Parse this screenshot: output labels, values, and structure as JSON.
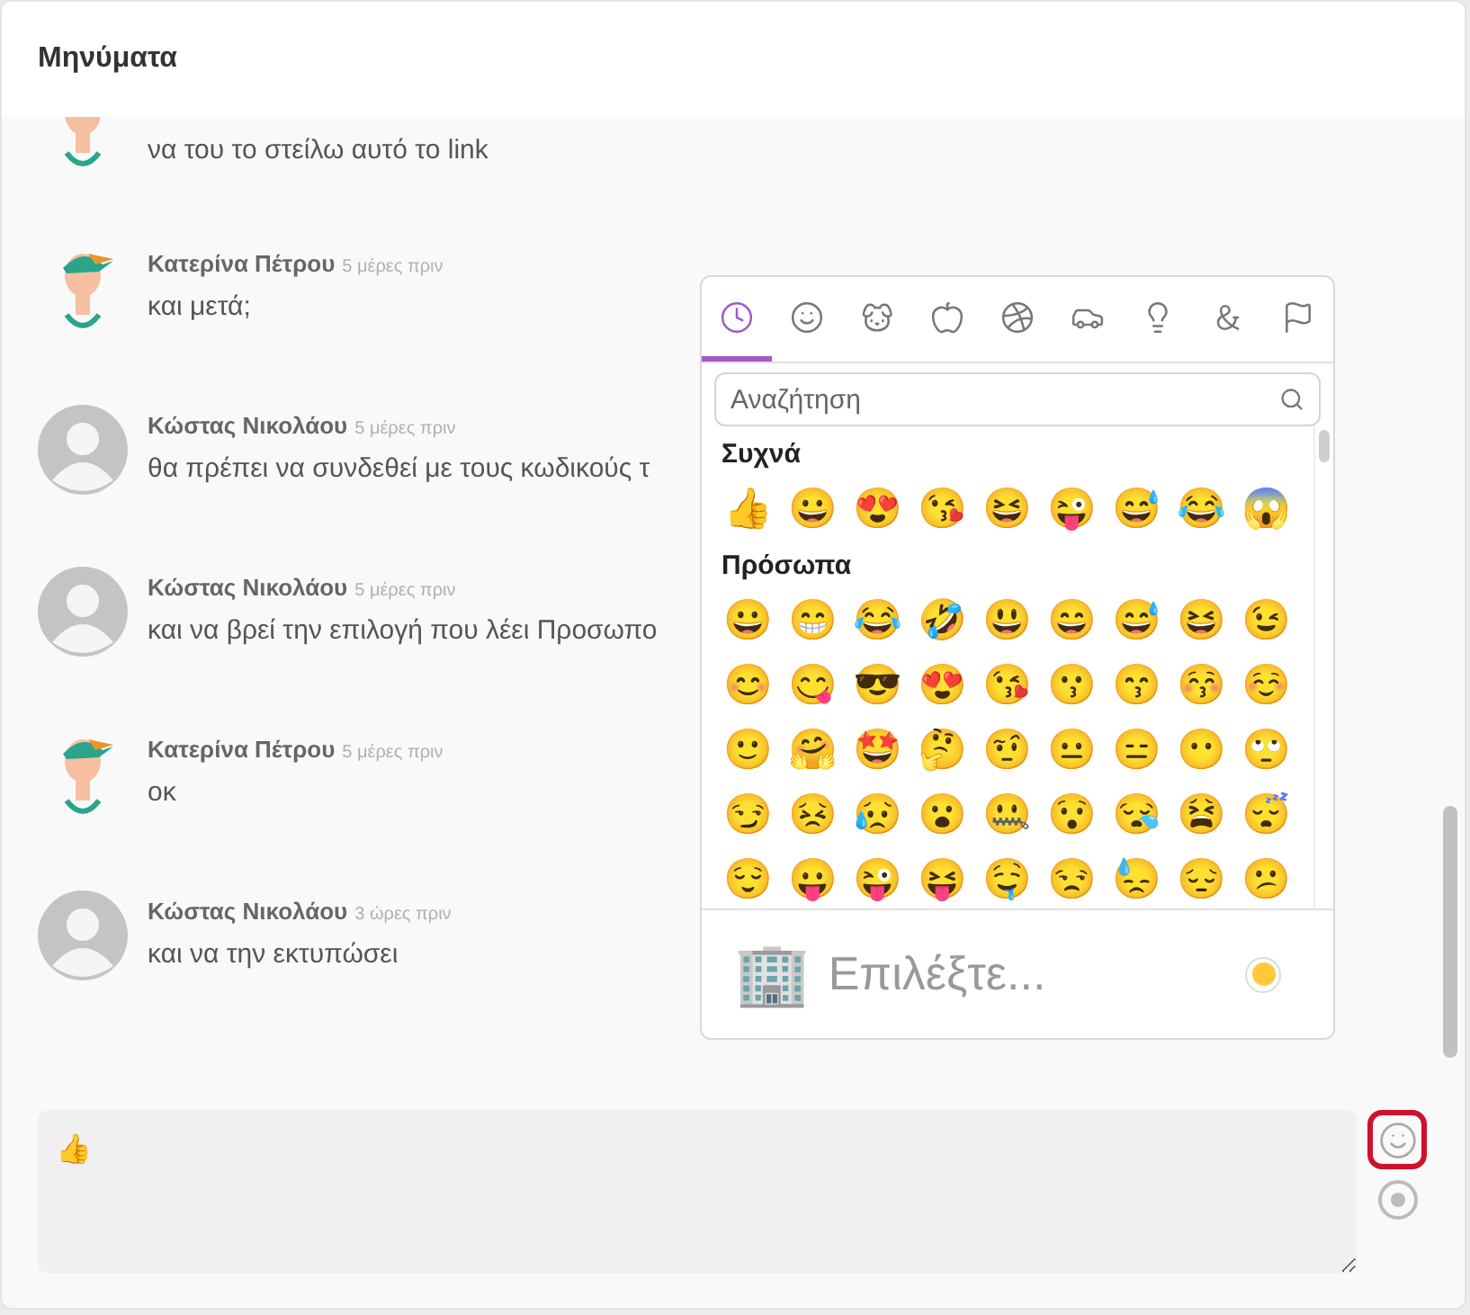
{
  "header": {
    "title": "Μηνύματα"
  },
  "messages": [
    {
      "kind": "cartoon",
      "text": "να του το στείλω αυτό το link"
    },
    {
      "kind": "cartoon",
      "author": "Κατερίνα Πέτρου",
      "time": "5 μέρες πριν",
      "text": "και μετά;"
    },
    {
      "kind": "default",
      "author": "Κώστας Νικολάου",
      "time": "5 μέρες πριν",
      "text": "θα πρέπει να συνδεθεί με τους κωδικούς τ"
    },
    {
      "kind": "default",
      "author": "Κώστας Νικολάου",
      "time": "5 μέρες πριν",
      "text": "και να βρεί την επιλογή που λέει Προσωπο"
    },
    {
      "kind": "cartoon",
      "author": "Κατερίνα Πέτρου",
      "time": "5 μέρες πριν",
      "text": "οκ"
    },
    {
      "kind": "default",
      "author": "Κώστας Νικολάου",
      "time": "3 ώρες πριν",
      "text": "και να την εκτυπώσει"
    }
  ],
  "emoji_picker": {
    "tabs": [
      {
        "kind": "recent",
        "selected": true
      },
      {
        "kind": "people",
        "selected": false
      },
      {
        "kind": "nature",
        "selected": false
      },
      {
        "kind": "foods",
        "selected": false
      },
      {
        "kind": "activity",
        "selected": false
      },
      {
        "kind": "places",
        "selected": false
      },
      {
        "kind": "objects",
        "selected": false
      },
      {
        "kind": "symbols",
        "selected": false
      },
      {
        "kind": "flags",
        "selected": false
      }
    ],
    "search": {
      "placeholder": "Αναζήτηση"
    },
    "sections": [
      {
        "title": "Συχνά",
        "emojis": [
          "👍",
          "😀",
          "😍",
          "😘",
          "😆",
          "😜",
          "😅",
          "😂",
          "😱"
        ]
      },
      {
        "title": "Πρόσωπα",
        "emojis": [
          "😀",
          "😁",
          "😂",
          "🤣",
          "😃",
          "😄",
          "😅",
          "😆",
          "😉",
          "😊",
          "😋",
          "😎",
          "😍",
          "😘",
          "😗",
          "😙",
          "😚",
          "☺️",
          "🙂",
          "🤗",
          "🤩",
          "🤔",
          "🤨",
          "😐",
          "😑",
          "😶",
          "🙄",
          "😏",
          "😣",
          "😥",
          "😮",
          "🤐",
          "😯",
          "😪",
          "😫",
          "😴",
          "😌",
          "😛",
          "😜",
          "😝",
          "🤤",
          "😒",
          "😓",
          "😔",
          "😕"
        ]
      }
    ],
    "preview": {
      "emoji": "🏢",
      "text": "Επιλέξτε..."
    }
  },
  "composer": {
    "value": "👍",
    "emoji_button_focused": true
  }
}
